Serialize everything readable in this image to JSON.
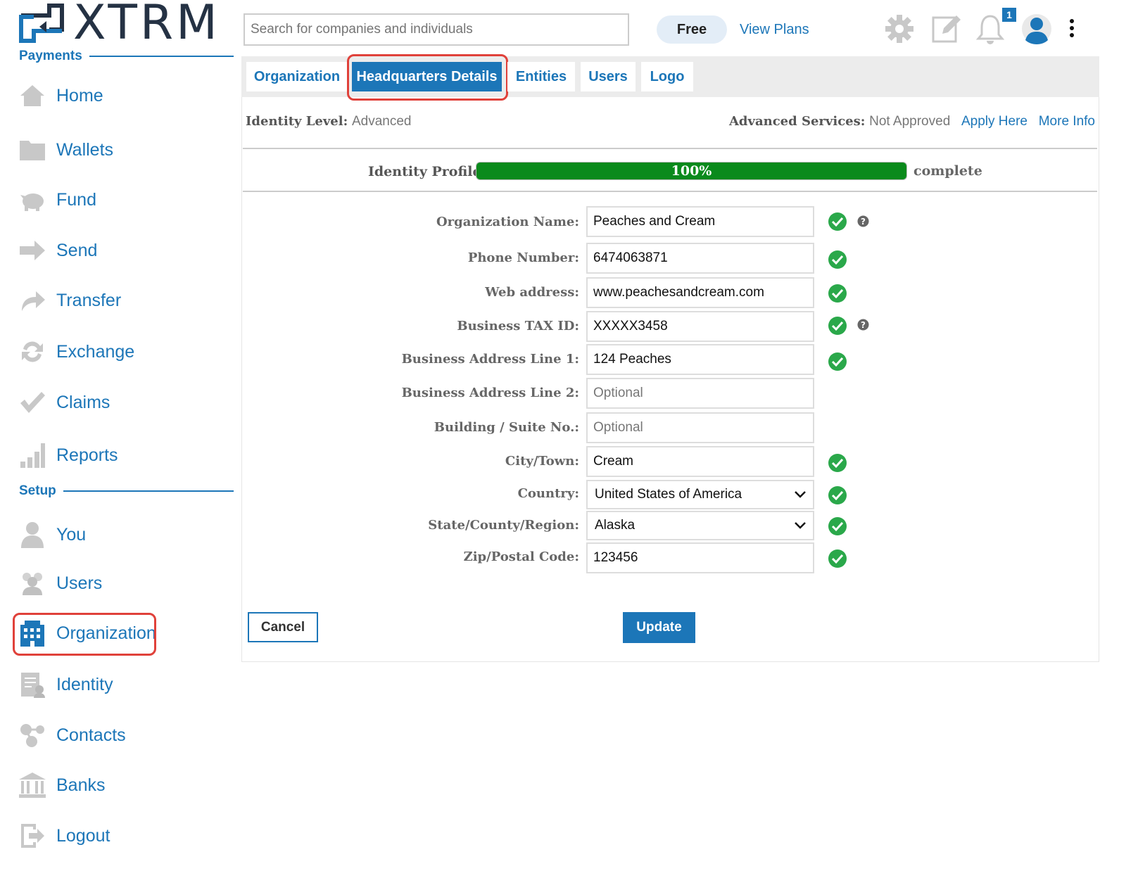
{
  "app": {
    "brand": "XTRM"
  },
  "sidebar": {
    "sections": [
      {
        "label": "Payments"
      },
      {
        "label": "Setup"
      }
    ],
    "items": [
      {
        "label": "Home",
        "icon": "home-icon"
      },
      {
        "label": "Wallets",
        "icon": "folder-icon"
      },
      {
        "label": "Fund",
        "icon": "piggy-bank-icon"
      },
      {
        "label": "Send",
        "icon": "arrow-right-icon"
      },
      {
        "label": "Transfer",
        "icon": "share-icon"
      },
      {
        "label": "Exchange",
        "icon": "exchange-icon"
      },
      {
        "label": "Claims",
        "icon": "checkmark-icon"
      },
      {
        "label": "Reports",
        "icon": "bar-chart-icon"
      },
      {
        "label": "You",
        "icon": "user-icon"
      },
      {
        "label": "Users",
        "icon": "users-icon"
      },
      {
        "label": "Organization",
        "icon": "building-icon",
        "active": true
      },
      {
        "label": "Identity",
        "icon": "id-card-icon"
      },
      {
        "label": "Contacts",
        "icon": "contacts-icon"
      },
      {
        "label": "Banks",
        "icon": "bank-icon"
      },
      {
        "label": "Logout",
        "icon": "logout-icon"
      }
    ]
  },
  "header": {
    "search_placeholder": "Search for companies and individuals",
    "plan_label": "Free",
    "view_plans": "View Plans",
    "notification_count": "1"
  },
  "tabs": [
    {
      "label": "Organization"
    },
    {
      "label": "Headquarters Details",
      "active": true
    },
    {
      "label": "Entities"
    },
    {
      "label": "Users"
    },
    {
      "label": "Logo"
    }
  ],
  "status": {
    "identity_level_label": "Identity Level:",
    "identity_level_value": "Advanced",
    "advanced_services_label": "Advanced Services:",
    "advanced_services_value": "Not Approved",
    "apply_here": "Apply Here",
    "more_info": "More Info"
  },
  "profile": {
    "label": "Identity Profile",
    "percent_text": "100%",
    "progress": 1.0,
    "suffix": "complete"
  },
  "form": {
    "fields": [
      {
        "label": "Organization Name:",
        "value": "Peaches and Cream",
        "placeholder": "",
        "verified": true,
        "help": true
      },
      {
        "label": "Phone Number:",
        "value": "6474063871",
        "placeholder": "",
        "verified": true,
        "help": false
      },
      {
        "label": "Web address:",
        "value": "www.peachesandcream.com",
        "placeholder": "",
        "verified": true,
        "help": false
      },
      {
        "label": "Business TAX ID:",
        "value": "XXXXX3458",
        "placeholder": "",
        "verified": true,
        "help": true
      },
      {
        "label": "Business Address Line 1:",
        "value": "124 Peaches",
        "placeholder": "",
        "verified": true,
        "help": false
      },
      {
        "label": "Business Address Line 2:",
        "value": "",
        "placeholder": "Optional",
        "verified": false,
        "help": false
      },
      {
        "label": "Building / Suite No.:",
        "value": "",
        "placeholder": "Optional",
        "verified": false,
        "help": false
      },
      {
        "label": "City/Town:",
        "value": "Cream",
        "placeholder": "",
        "verified": true,
        "help": false
      }
    ],
    "country": {
      "label": "Country:",
      "value": "United States of America"
    },
    "state": {
      "label": "State/County/Region:",
      "value": "Alaska"
    },
    "zip": {
      "label": "Zip/Postal Code:",
      "value": "123456"
    },
    "cancel_label": "Cancel",
    "update_label": "Update"
  },
  "colors": {
    "accent": "#1c76b8",
    "success": "#2aa84a",
    "progress": "#0a8a1c",
    "highlight": "#e0413a"
  }
}
